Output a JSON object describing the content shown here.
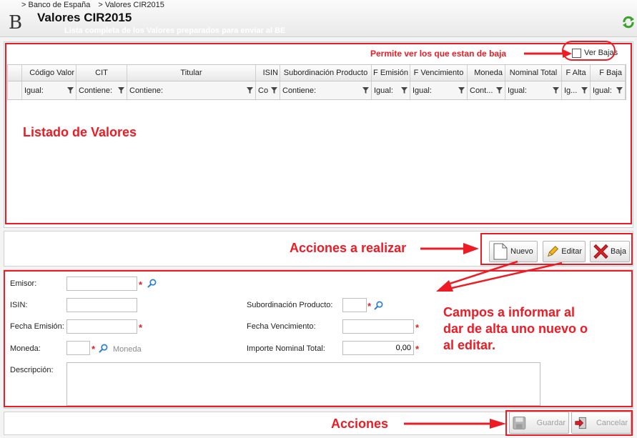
{
  "header": {
    "breadcrumb": [
      "> Banco de España",
      "> Valores CIR2015"
    ],
    "logo": "B",
    "title": "Valores CIR2015",
    "subtitle": "Lista completa de los Valores preparados para enviar al BE"
  },
  "grid": {
    "show_deleted_label": "Ver Bajas",
    "columns": [
      {
        "label": "Código Valor",
        "filter": "Igual:"
      },
      {
        "label": "CIT",
        "filter": "Contiene:"
      },
      {
        "label": "Titular",
        "filter": "Contiene:"
      },
      {
        "label": "ISIN",
        "filter": "Co"
      },
      {
        "label": "Subordinación Producto",
        "filter": "Contiene:"
      },
      {
        "label": "F Emisión",
        "filter": "Igual:"
      },
      {
        "label": "F Vencimiento",
        "filter": "Igual:"
      },
      {
        "label": "Moneda",
        "filter": "Cont..."
      },
      {
        "label": "Nominal Total",
        "filter": "Igual:"
      },
      {
        "label": "F Alta",
        "filter": "Ig..."
      },
      {
        "label": "F Baja",
        "filter": "Igual:"
      }
    ]
  },
  "actions": {
    "new_label": "Nuevo",
    "edit_label": "Editar",
    "delete_label": "Baja",
    "save_label": "Guardar",
    "cancel_label": "Cancelar"
  },
  "form": {
    "emisor_label": "Emisor:",
    "isin_label": "ISIN:",
    "fecha_emision_label": "Fecha Emisión:",
    "moneda_label": "Moneda:",
    "moneda_hint": "Moneda",
    "descripcion_label": "Descripción:",
    "subordinacion_label": "Subordinación Producto:",
    "fecha_vencimiento_label": "Fecha Vencimiento:",
    "importe_label": "Importe Nominal Total:",
    "importe_value": "0,00",
    "required_mark": "*"
  },
  "annotations": {
    "ver_bajas": "Permite ver los que estan de baja",
    "listado": "Listado de Valores",
    "acciones_realizar": "Acciones a realizar",
    "campos_line1": "Campos a informar al",
    "campos_line2": "dar de alta uno nuevo o",
    "campos_line3": "al editar.",
    "acciones": "Acciones"
  },
  "colors": {
    "annotation_red": "#ee1b24",
    "header_bg": "#ececec",
    "panel_bg": "#ffffff"
  }
}
